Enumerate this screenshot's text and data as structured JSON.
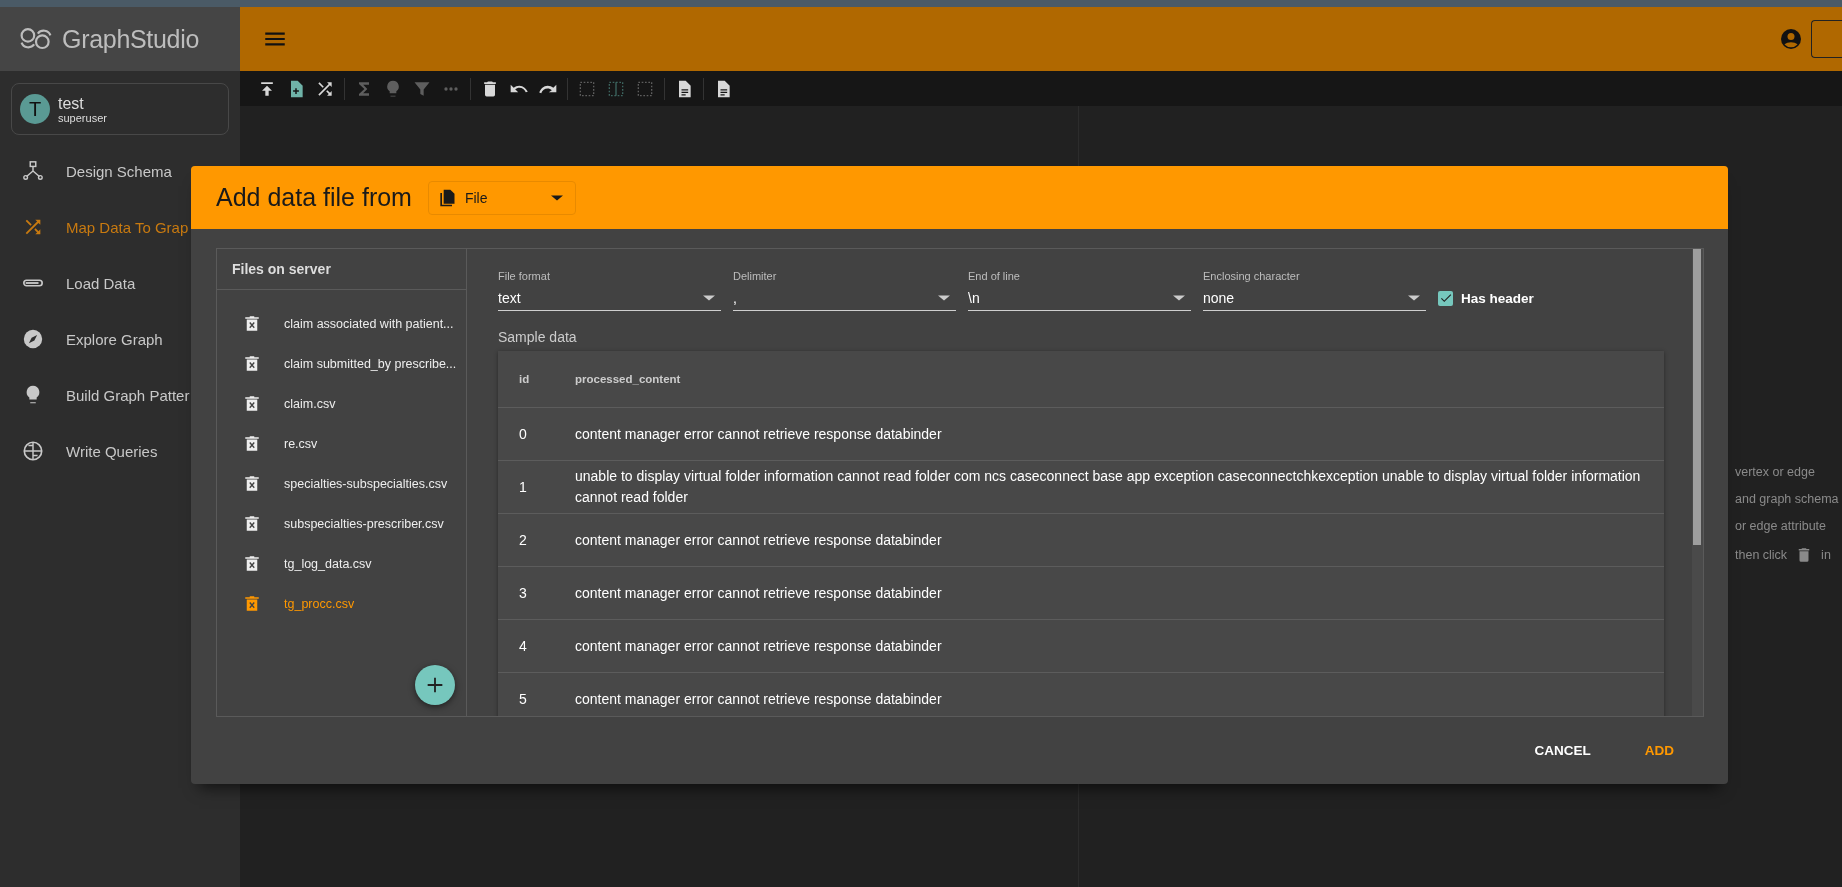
{
  "app": {
    "logo_text": "GraphStudio",
    "user": {
      "initial": "T",
      "name": "test",
      "role": "superuser"
    }
  },
  "sidebar": {
    "items": [
      {
        "label": "Design Schema",
        "selected": false
      },
      {
        "label": "Map Data To Grap",
        "selected": true
      },
      {
        "label": "Load Data",
        "selected": false
      },
      {
        "label": "Explore Graph",
        "selected": false
      },
      {
        "label": "Build Graph Patter",
        "selected": false
      },
      {
        "label": "Write Queries",
        "selected": false
      }
    ]
  },
  "toolbar": {
    "groups": [
      [
        {
          "kind": "upload",
          "disabled": false
        },
        {
          "kind": "addfile",
          "disabled": false
        },
        {
          "kind": "shuffle",
          "disabled": false
        }
      ],
      [
        {
          "kind": "sigma",
          "disabled": true
        },
        {
          "kind": "bulb",
          "disabled": true
        },
        {
          "kind": "filter",
          "disabled": true
        },
        {
          "kind": "more",
          "disabled": true
        }
      ],
      [
        {
          "kind": "trash",
          "disabled": false
        },
        {
          "kind": "undo",
          "disabled": false
        },
        {
          "kind": "redo",
          "disabled": false
        }
      ],
      [
        {
          "kind": "square",
          "disabled": true
        },
        {
          "kind": "columns",
          "disabled": true
        },
        {
          "kind": "square",
          "disabled": true
        }
      ],
      [
        {
          "kind": "doc",
          "disabled": false
        }
      ],
      [
        {
          "kind": "doc",
          "disabled": false
        }
      ]
    ]
  },
  "hints": [
    "vertex or edge",
    "and graph schema",
    "or edge attribute"
  ],
  "hint_last": {
    "before": "then click",
    "after": "in"
  },
  "dialog": {
    "title": "Add data file from",
    "source": "File",
    "files_heading": "Files on server",
    "files": [
      {
        "name": "claim associated with patient...",
        "selected": false
      },
      {
        "name": "claim submitted_by prescribe...",
        "selected": false
      },
      {
        "name": "claim.csv",
        "selected": false
      },
      {
        "name": "re.csv",
        "selected": false
      },
      {
        "name": "specialties-subspecialties.csv",
        "selected": false
      },
      {
        "name": "subspecialties-prescriber.csv",
        "selected": false
      },
      {
        "name": "tg_log_data.csv",
        "selected": false
      },
      {
        "name": "tg_procc.csv",
        "selected": true
      }
    ],
    "fields": [
      {
        "label": "File format",
        "value": "text"
      },
      {
        "label": "Delimiter",
        "value": ","
      },
      {
        "label": "End of line",
        "value": "\\n"
      },
      {
        "label": "Enclosing character",
        "value": "none"
      }
    ],
    "has_header": {
      "label": "Has header",
      "checked": true
    },
    "sample_label": "Sample data",
    "table": {
      "columns": [
        "id",
        "processed_content"
      ],
      "rows": [
        [
          "0",
          "content manager error cannot retrieve response databinder"
        ],
        [
          "1",
          "unable to display virtual folder information cannot read folder com ncs caseconnect base app exception caseconnectchkexception unable to display virtual folder information cannot read folder"
        ],
        [
          "2",
          "content manager error cannot retrieve response databinder"
        ],
        [
          "3",
          "content manager error cannot retrieve response databinder"
        ],
        [
          "4",
          "content manager error cannot retrieve response databinder"
        ],
        [
          "5",
          "content manager error cannot retrieve response databinder"
        ]
      ]
    },
    "buttons": [
      {
        "label": "CANCEL",
        "kind": "secondary"
      },
      {
        "label": "ADD",
        "kind": "primary"
      }
    ]
  }
}
